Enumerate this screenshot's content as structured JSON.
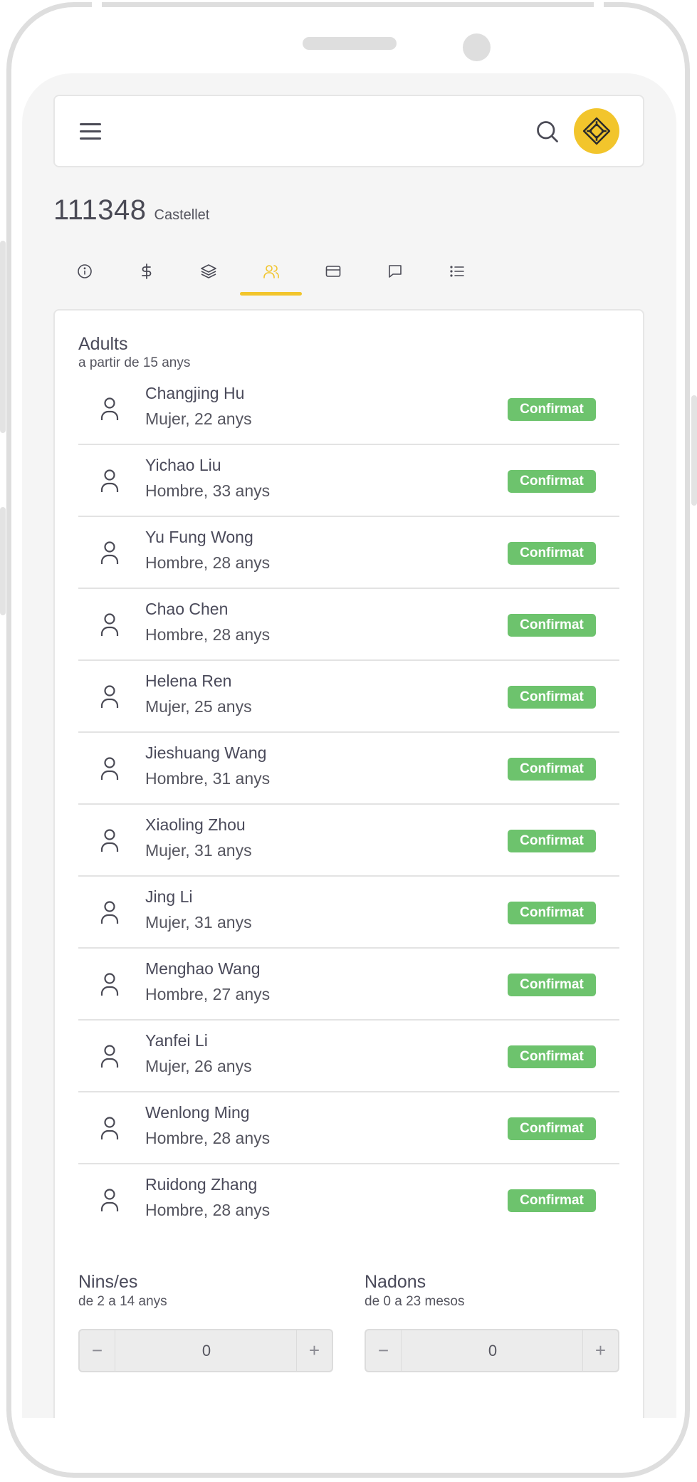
{
  "header": {
    "record_number": "111348",
    "record_name": "Castellet"
  },
  "tabs": [
    {
      "icon": "info-icon"
    },
    {
      "icon": "dollar-icon"
    },
    {
      "icon": "layers-icon"
    },
    {
      "icon": "users-icon",
      "active": true
    },
    {
      "icon": "credit-card-icon"
    },
    {
      "icon": "message-icon"
    },
    {
      "icon": "list-icon"
    }
  ],
  "adults": {
    "title": "Adults",
    "subtitle": "a partir de 15 anys",
    "status_label": "Confirmat",
    "people": [
      {
        "name": "Changjing Hu",
        "info": "Mujer, 22 anys"
      },
      {
        "name": "Yichao Liu",
        "info": "Hombre, 33 anys"
      },
      {
        "name": "Yu Fung Wong",
        "info": "Hombre, 28 anys"
      },
      {
        "name": "Chao Chen",
        "info": "Hombre, 28 anys"
      },
      {
        "name": "Helena Ren",
        "info": "Mujer, 25 anys"
      },
      {
        "name": "Jieshuang Wang",
        "info": "Hombre, 31 anys"
      },
      {
        "name": "Xiaoling Zhou",
        "info": "Mujer, 31 anys"
      },
      {
        "name": "Jing Li",
        "info": "Mujer, 31 anys"
      },
      {
        "name": "Menghao Wang",
        "info": "Hombre, 27 anys"
      },
      {
        "name": "Yanfei Li",
        "info": "Mujer, 26 anys"
      },
      {
        "name": "Wenlong Ming",
        "info": "Hombre, 28 anys"
      },
      {
        "name": "Ruidong Zhang",
        "info": "Hombre, 28 anys"
      }
    ]
  },
  "children": {
    "title": "Nins/es",
    "subtitle": "de 2 a 14 anys",
    "value": "0",
    "minus": "−",
    "plus": "+"
  },
  "babies": {
    "title": "Nadons",
    "subtitle": "de 0 a 23 mesos",
    "value": "0",
    "minus": "−",
    "plus": "+"
  },
  "colors": {
    "accent": "#f2c52c",
    "confirmed": "#6dc36d",
    "text": "#4a4a5a"
  }
}
